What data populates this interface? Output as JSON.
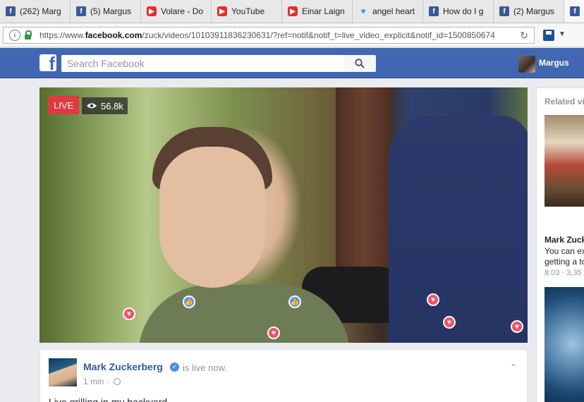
{
  "browser": {
    "tabs": [
      {
        "icon": "facebook-icon",
        "label": "(262) Marg"
      },
      {
        "icon": "facebook-icon",
        "label": "(5) Margus"
      },
      {
        "icon": "youtube-icon",
        "label": "Volare - Do"
      },
      {
        "icon": "youtube-icon",
        "label": "YouTube"
      },
      {
        "icon": "youtube-icon",
        "label": "Einar Laign"
      },
      {
        "icon": "twitter-icon",
        "label": "angel heart"
      },
      {
        "icon": "facebook-icon",
        "label": "How do I g"
      },
      {
        "icon": "facebook-icon",
        "label": "(2) Margus"
      },
      {
        "icon": "facebook-icon",
        "label": ""
      }
    ],
    "url_prefix": "https://www.",
    "url_domain": "facebook.com",
    "url_rest": "/zuck/videos/10103911836230631/?ref=notif&notif_t=live_video_explicit&notif_id=1500850674"
  },
  "header": {
    "logo": "f",
    "search_placeholder": "Search Facebook",
    "user_name": "Margus"
  },
  "video": {
    "live_label": "LIVE",
    "viewer_count": "56.8k"
  },
  "post": {
    "author": "Mark Zuckerberg",
    "status": "is live now.",
    "time": "1 min ·",
    "text": "Live grilling in my backyard"
  },
  "related": {
    "heading": "Related videos",
    "item_title": "Mark Zuckerberg",
    "item_desc_1": "You can ex",
    "item_desc_2": "getting a to",
    "item_meta": "8:03 · 3,35"
  },
  "colors": {
    "facebook_blue": "#4267b2",
    "live_red": "#e0393e",
    "heart": "#f25268",
    "like": "#5890ff"
  }
}
